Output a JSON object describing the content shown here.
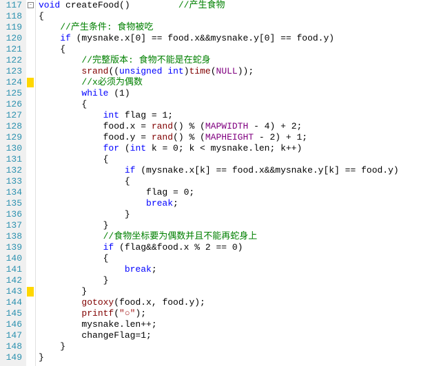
{
  "lines": [
    {
      "n": 117,
      "fold": true,
      "html": "<span class='kw'>void</span> createFood()         <span class='cmt'>//产生食物</span>"
    },
    {
      "n": 118,
      "html": "{"
    },
    {
      "n": 119,
      "html": "    <span class='cmt'>//产生条件: 食物被吃</span>"
    },
    {
      "n": 120,
      "html": "    <span class='kw'>if</span> (mysnake.x[0] == food.x&&mysnake.y[0] == food.y)"
    },
    {
      "n": 121,
      "html": "    {"
    },
    {
      "n": 122,
      "html": "        <span class='cmt'>//完整版本: 食物不能是在蛇身</span>"
    },
    {
      "n": 123,
      "html": "        <span class='func'>srand</span>((<span class='kw'>unsigned</span> <span class='kw'>int</span>)<span class='func'>time</span>(<span class='const'>NULL</span>));"
    },
    {
      "n": 124,
      "mark": true,
      "html": "        <span class='cmt'>//x必须为偶数</span>"
    },
    {
      "n": 125,
      "html": "        <span class='kw'>while</span> (1)"
    },
    {
      "n": 126,
      "html": "        {"
    },
    {
      "n": 127,
      "html": "            <span class='kw'>int</span> flag = 1;"
    },
    {
      "n": 128,
      "html": "            food.x = <span class='func'>rand</span>() % (<span class='const'>MAPWIDTH</span> - 4) + 2;"
    },
    {
      "n": 129,
      "html": "            food.y = <span class='func'>rand</span>() % (<span class='const'>MAPHEIGHT</span> - 2) + 1;"
    },
    {
      "n": 130,
      "html": "            <span class='kw'>for</span> (<span class='kw'>int</span> k = 0; k &lt; mysnake.len; k++)"
    },
    {
      "n": 131,
      "html": "            {"
    },
    {
      "n": 132,
      "html": "                <span class='kw'>if</span> (mysnake.x[k] == food.x&&mysnake.y[k] == food.y)"
    },
    {
      "n": 133,
      "html": "                {"
    },
    {
      "n": 134,
      "html": "                    flag = 0;"
    },
    {
      "n": 135,
      "html": "                    <span class='kw'>break</span>;"
    },
    {
      "n": 136,
      "html": "                }"
    },
    {
      "n": 137,
      "html": "            }"
    },
    {
      "n": 138,
      "html": "            <span class='cmt'>//食物坐标要为偶数并且不能再蛇身上</span>"
    },
    {
      "n": 139,
      "html": "            <span class='kw'>if</span> (flag&&food.x % 2 == 0)"
    },
    {
      "n": 140,
      "html": "            {"
    },
    {
      "n": 141,
      "html": "                <span class='kw'>break</span>;"
    },
    {
      "n": 142,
      "html": "            }"
    },
    {
      "n": 143,
      "mark": true,
      "html": "        }"
    },
    {
      "n": 144,
      "html": "        <span class='func'>gotoxy</span>(food.x, food.y);"
    },
    {
      "n": 145,
      "html": "        <span class='func'>printf</span>(<span class='str'>\"○\"</span>);"
    },
    {
      "n": 146,
      "html": "        mysnake.len++;"
    },
    {
      "n": 147,
      "html": "        changeFlag=1;"
    },
    {
      "n": 148,
      "html": "    }"
    },
    {
      "n": 149,
      "html": "}"
    }
  ]
}
